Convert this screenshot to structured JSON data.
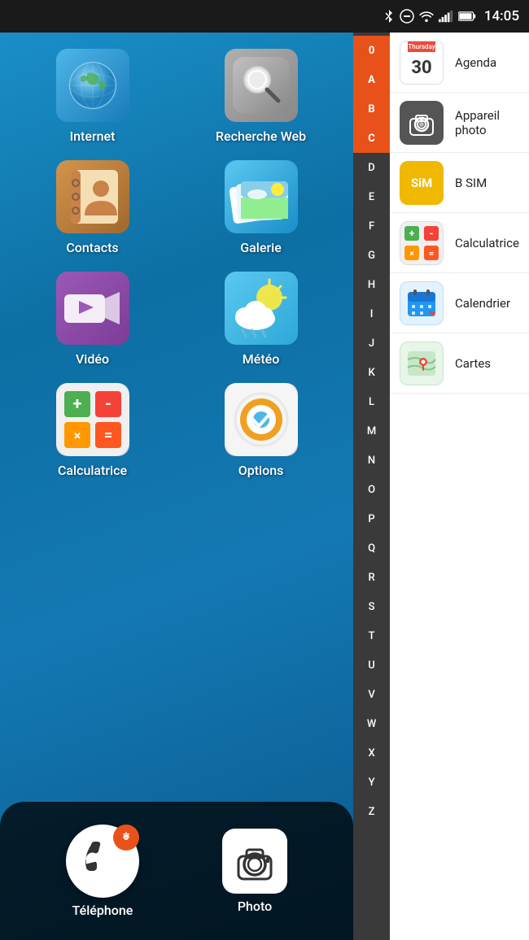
{
  "statusBar": {
    "time": "14:05",
    "icons": [
      "bluetooth",
      "minus-circle",
      "wifi",
      "signal",
      "battery"
    ]
  },
  "homeScreen": {
    "apps": [
      {
        "id": "internet",
        "label": "Internet",
        "icon": "globe"
      },
      {
        "id": "recherche-web",
        "label": "Recherche Web",
        "icon": "search"
      },
      {
        "id": "contacts",
        "label": "Contacts",
        "icon": "contacts"
      },
      {
        "id": "galerie",
        "label": "Galerie",
        "icon": "gallery"
      },
      {
        "id": "video",
        "label": "Vidéo",
        "icon": "video"
      },
      {
        "id": "meteo",
        "label": "Météo",
        "icon": "weather"
      },
      {
        "id": "calculatrice",
        "label": "Calculatrice",
        "icon": "calculator"
      },
      {
        "id": "options",
        "label": "Options",
        "icon": "options"
      }
    ],
    "dock": [
      {
        "id": "telephone",
        "label": "Téléphone",
        "icon": "phone"
      },
      {
        "id": "photo",
        "label": "Photo",
        "icon": "camera"
      }
    ]
  },
  "alphaIndex": {
    "letters": [
      "0",
      "A",
      "B",
      "C",
      "D",
      "E",
      "F",
      "G",
      "H",
      "I",
      "J",
      "K",
      "L",
      "M",
      "N",
      "O",
      "P",
      "Q",
      "R",
      "S",
      "T",
      "U",
      "V",
      "W",
      "X",
      "Y",
      "Z"
    ],
    "activeLetter": "C"
  },
  "appList": [
    {
      "id": "agenda",
      "label": "Agenda",
      "icon": "calendar",
      "iconType": "calendar",
      "day": "30",
      "dayLabel": "Thursday"
    },
    {
      "id": "appareil-photo",
      "label": "Appareil photo",
      "icon": "camera",
      "iconType": "camera"
    },
    {
      "id": "b-sim",
      "label": "B SIM",
      "icon": "sim",
      "iconType": "sim"
    },
    {
      "id": "calculatrice2",
      "label": "Calculatrice",
      "icon": "calculator",
      "iconType": "calc"
    },
    {
      "id": "calendar2",
      "label": "Calendrier",
      "icon": "calendar2",
      "iconType": "cal2"
    },
    {
      "id": "cartes",
      "label": "Cartes",
      "icon": "map",
      "iconType": "map"
    }
  ]
}
